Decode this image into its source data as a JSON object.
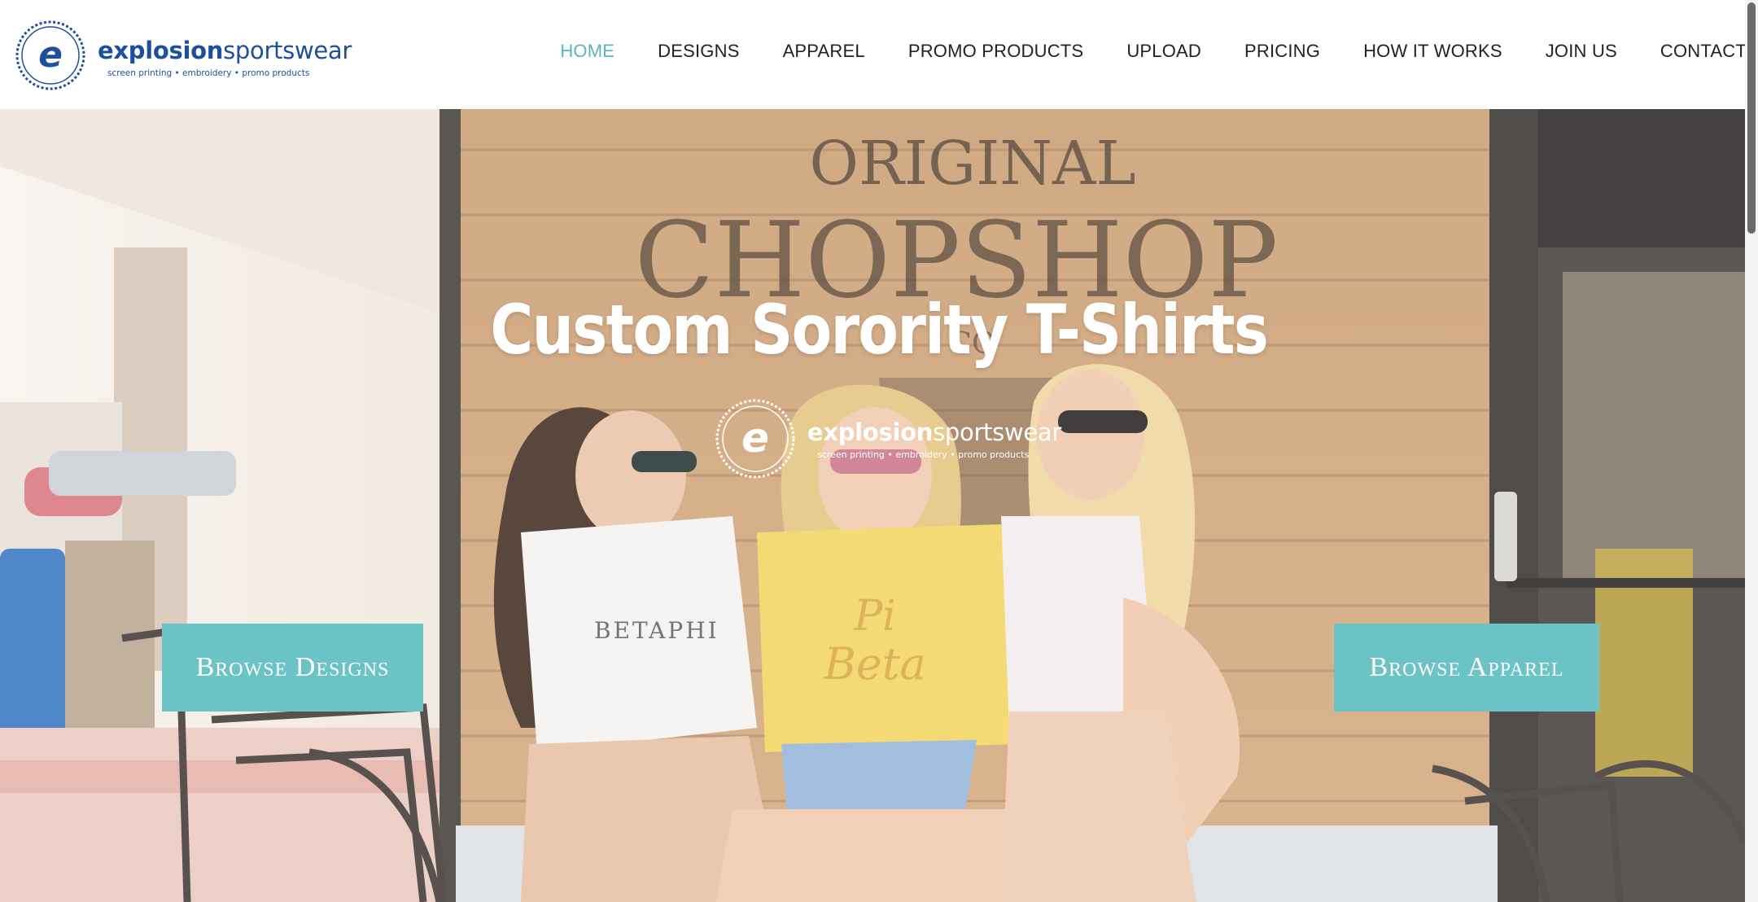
{
  "brand": {
    "badge_letter": "e",
    "word_bold": "explosion",
    "word_light": "sportswear",
    "tagline": "screen printing • embroidery • promo products",
    "color": "#1d4f9c"
  },
  "nav": {
    "items": [
      "HOME",
      "DESIGNS",
      "APPAREL",
      "PROMO PRODUCTS",
      "UPLOAD",
      "PRICING",
      "HOW IT WORKS",
      "JOIN US",
      "CONTACT"
    ],
    "active": "HOME",
    "active_color": "#5bb5bf"
  },
  "hero": {
    "sign_line1": "ORIGINAL",
    "sign_line2": "CHOPSHOP",
    "sign_line3": "CO",
    "title": "Custom Sorority T-Shirts",
    "shirt_text_left": "BETAPHI",
    "shirt_text_center_1": "Pi",
    "shirt_text_center_2": "Beta",
    "browse_designs_label": "Browse Designs",
    "browse_apparel_label": "Browse Apparel",
    "button_color": "#6cc3c5"
  }
}
